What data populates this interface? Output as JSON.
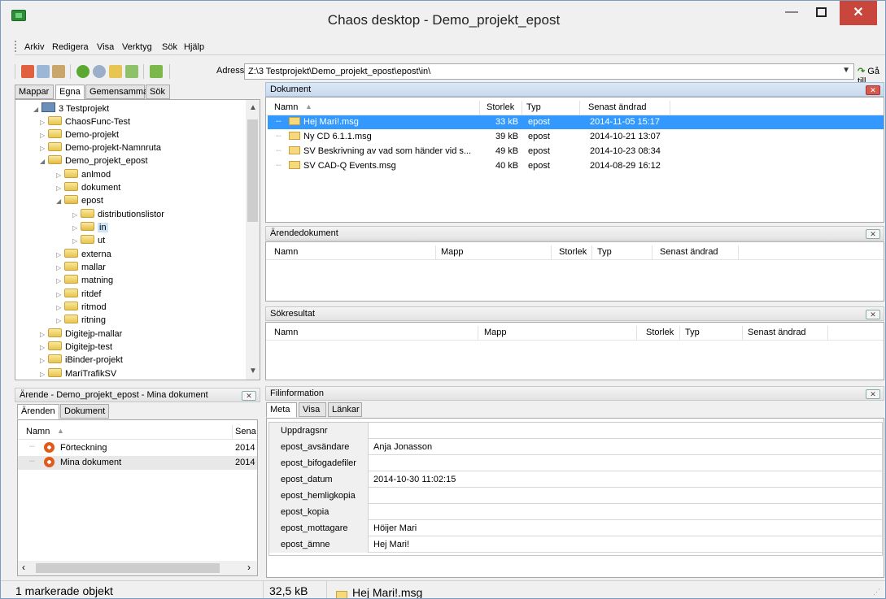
{
  "window": {
    "title": "Chaos desktop - Demo_projekt_epost",
    "min": "—",
    "close": "✕"
  },
  "menu": [
    "Arkiv",
    "Redigera",
    "Visa",
    "Verktyg",
    "Sök",
    "Hjälp"
  ],
  "address": {
    "label": "Adress:",
    "value": "Z:\\3 Testprojekt\\Demo_projekt_epost\\epost\\in\\",
    "go": "Gå till"
  },
  "left_tabs": [
    "Mappar",
    "Egna",
    "Gemensamma",
    "Sök"
  ],
  "tree": [
    {
      "label": "3 Testprojekt",
      "kind": "project",
      "expanded": true
    },
    {
      "label": "ChaosFunc-Test"
    },
    {
      "label": "Demo-projekt"
    },
    {
      "label": "Demo-projekt-Namnruta"
    },
    {
      "label": "Demo_projekt_epost",
      "expanded": true
    },
    {
      "label": "anlmod"
    },
    {
      "label": "dokument"
    },
    {
      "label": "epost",
      "expanded": true
    },
    {
      "label": "distributionslistor"
    },
    {
      "label": "in",
      "selected": true
    },
    {
      "label": "ut"
    },
    {
      "label": "externa"
    },
    {
      "label": "mallar"
    },
    {
      "label": "matning"
    },
    {
      "label": "ritdef"
    },
    {
      "label": "ritmod"
    },
    {
      "label": "ritning"
    },
    {
      "label": "Digitejp-mallar"
    },
    {
      "label": "Digitejp-test"
    },
    {
      "label": "iBinder-projekt"
    },
    {
      "label": "MariTrafikSV"
    }
  ],
  "dokument": {
    "header": "Dokument",
    "columns": [
      "Namn",
      "Storlek",
      "Typ",
      "Senast ändrad"
    ],
    "rows": [
      {
        "name": "Hej Mari!.msg",
        "size": "33 kB",
        "type": "epost",
        "date": "2014-11-05 15:17",
        "selected": true
      },
      {
        "name": "Ny CD 6.1.1.msg",
        "size": "39 kB",
        "type": "epost",
        "date": "2014-10-21 13:07"
      },
      {
        "name": "SV Beskrivning av vad som händer vid s...",
        "size": "49 kB",
        "type": "epost",
        "date": "2014-10-23 08:34"
      },
      {
        "name": "SV CAD-Q Events.msg",
        "size": "40 kB",
        "type": "epost",
        "date": "2014-08-29 16:12"
      }
    ]
  },
  "arendedokument": {
    "header": "Ärendedokument",
    "columns": [
      "Namn",
      "Mapp",
      "Storlek",
      "Typ",
      "Senast ändrad"
    ]
  },
  "sokresultat": {
    "header": "Sökresultat",
    "columns": [
      "Namn",
      "Mapp",
      "Storlek",
      "Typ",
      "Senast ändrad"
    ]
  },
  "arende": {
    "header": "Ärende - Demo_projekt_epost - Mina dokument",
    "tabs": [
      "Ärenden",
      "Dokument"
    ],
    "columns": [
      "Namn",
      "Sena"
    ],
    "rows": [
      {
        "name": "Förteckning",
        "date": "2014"
      },
      {
        "name": "Mina dokument",
        "date": "2014"
      }
    ]
  },
  "filinfo": {
    "header": "Filinformation",
    "tabs": [
      "Meta",
      "Visa",
      "Länkar"
    ],
    "rows": [
      {
        "key": "Uppdragsnr",
        "value": ""
      },
      {
        "key": "epost_avsändare",
        "value": "Anja Jonasson"
      },
      {
        "key": "epost_bifogadefiler",
        "value": ""
      },
      {
        "key": "epost_datum",
        "value": "2014-10-30 11:02:15"
      },
      {
        "key": "epost_hemligkopia",
        "value": ""
      },
      {
        "key": "epost_kopia",
        "value": ""
      },
      {
        "key": "epost_mottagare",
        "value": "Höijer Mari"
      },
      {
        "key": "epost_ämne",
        "value": "Hej Mari!"
      }
    ]
  },
  "status": {
    "selected": "1 markerade objekt",
    "size": "32,5 kB",
    "file": "Hej Mari!.msg"
  },
  "colors": {
    "selection": "#3399ff",
    "close": "#c9463d",
    "header_blue": "#c8daef"
  }
}
